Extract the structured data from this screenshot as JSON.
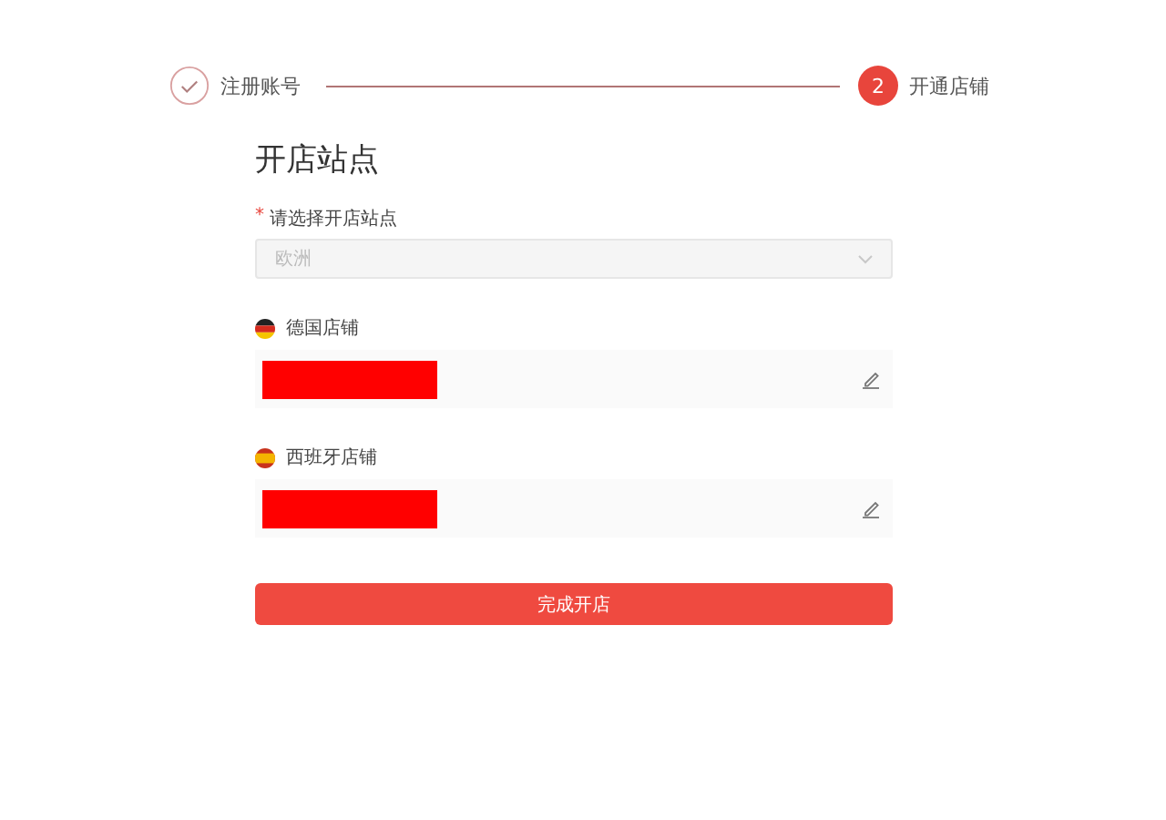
{
  "steps": [
    {
      "label": "注册账号",
      "completed": true
    },
    {
      "number": "2",
      "label": "开通店铺",
      "completed": false
    }
  ],
  "form": {
    "title": "开店站点",
    "site": {
      "label": "请选择开店站点",
      "required_mark": "*",
      "value": "欧洲",
      "disabled": true
    },
    "shops": [
      {
        "kind": "germany",
        "label": "德国店铺",
        "redacted": true
      },
      {
        "kind": "spain",
        "label": "西班牙店铺",
        "redacted": true
      }
    ],
    "submit": "完成开店"
  }
}
